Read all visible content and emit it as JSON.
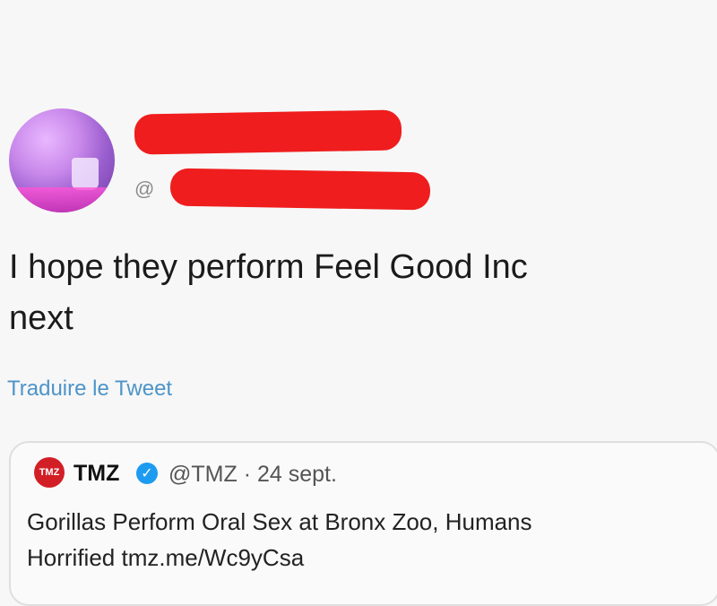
{
  "tweet": {
    "handle_prefix": "@",
    "text": "I hope they perform Feel Good Inc\nnext",
    "translate_label": "Traduire le Tweet"
  },
  "quoted": {
    "avatar_label": "TMZ",
    "name": "TMZ",
    "handle": "@TMZ",
    "separator": "·",
    "date": "24 sept.",
    "text": "Gorillas Perform Oral Sex at Bronx Zoo, Humans\nHorrified tmz.me/Wc9yCsa"
  },
  "colors": {
    "redaction": "#ef1d1d",
    "link": "#4d94c9",
    "verified": "#1d9bf0",
    "tmz_red": "#d21f26"
  }
}
